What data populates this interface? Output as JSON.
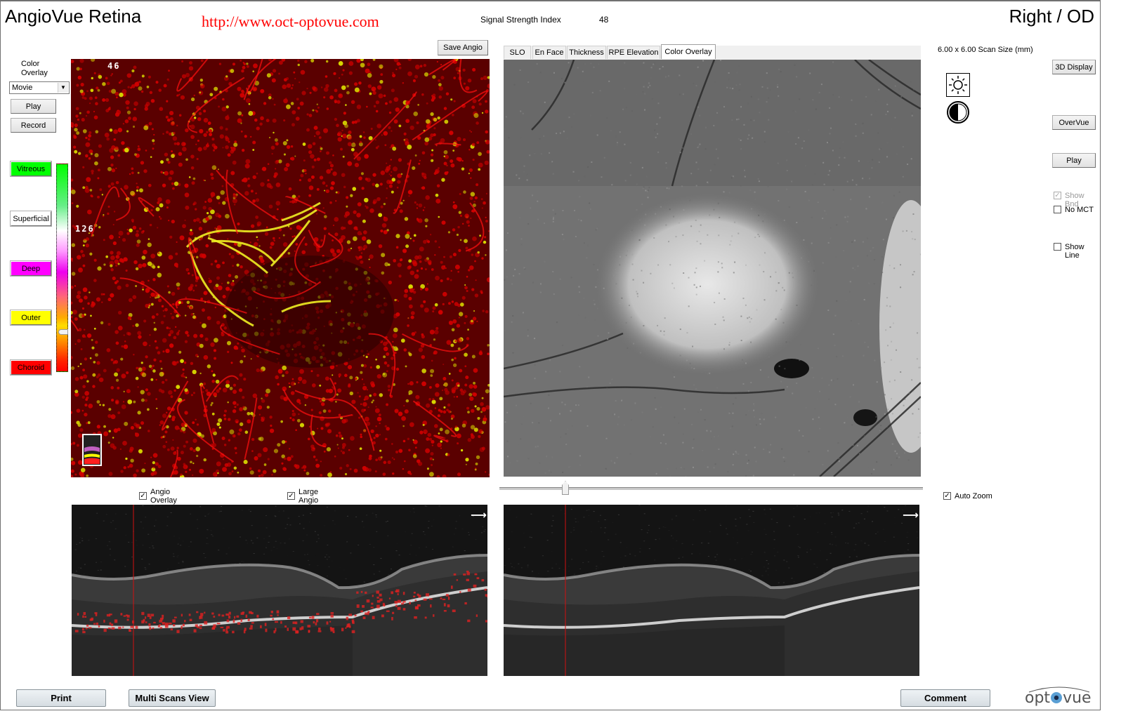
{
  "header": {
    "app_title": "AngioVue Retina",
    "website_url": "http://www.oct-optovue.com",
    "signal_strength_label": "Signal Strength Index",
    "signal_strength_value": "48",
    "eye_label": "Right / OD"
  },
  "left_panel": {
    "color_overlay_label_line1": "Color",
    "color_overlay_label_line2": "Overlay",
    "color_overlay_select": {
      "selected": "Movie",
      "icon": "chevron-down-icon"
    },
    "play_label": "Play",
    "record_label": "Record",
    "layers": [
      {
        "label": "Vitreous",
        "color": "#00ff00"
      },
      {
        "label": "Superficial",
        "color": "#ffffff"
      },
      {
        "label": "Deep",
        "color": "#ff00ff"
      },
      {
        "label": "Outer",
        "color": "#ffff00"
      },
      {
        "label": "Choroid",
        "color": "#ff0000"
      }
    ],
    "colorbar_handle_position_fraction": 0.8
  },
  "angio_panel": {
    "save_label": "Save Angio",
    "top_number": "46",
    "side_number": "126",
    "legend_icon": "layer-legend-icon",
    "angio_overlay_label_line1": "Angio",
    "angio_overlay_label_line2": "Overlay",
    "angio_overlay_checked": true,
    "large_angio_label_line1": "Large",
    "large_angio_label_line2": "Angio",
    "large_angio_checked": true
  },
  "slo_panel": {
    "tabs": [
      {
        "label": "SLO",
        "active": false
      },
      {
        "label": "En Face",
        "active": false
      },
      {
        "label": "Thickness",
        "active": false
      },
      {
        "label": "RPE Elevation",
        "active": false
      },
      {
        "label": "Color Overlay",
        "active": true
      }
    ],
    "scan_slider_fraction": 0.15
  },
  "right_panel": {
    "scan_size": "6.00 x 6.00 Scan Size (mm)",
    "brightness_icon": "sun-icon",
    "contrast_icon": "contrast-icon",
    "display_3d_label": "3D Display",
    "overvue_label": "OverVue",
    "play_label": "Play",
    "show_bnd_label": "Show Bnd",
    "show_bnd_checked": true,
    "show_bnd_disabled": true,
    "no_mct_label": "No MCT",
    "no_mct_checked": false,
    "show_line_label": "Show Line",
    "show_line_checked": false,
    "auto_zoom_label": "Auto Zoom",
    "auto_zoom_checked": true
  },
  "footer": {
    "print_label": "Print",
    "multi_scans_label": "Multi Scans View",
    "comment_label": "Comment",
    "logo_text_left": "opt",
    "logo_text_right": "vue"
  },
  "colors": {
    "url_red": "#ff0000",
    "scan_line_red": "#d01010",
    "angio_red": "#d00000",
    "angio_yellow": "#d8d800"
  }
}
